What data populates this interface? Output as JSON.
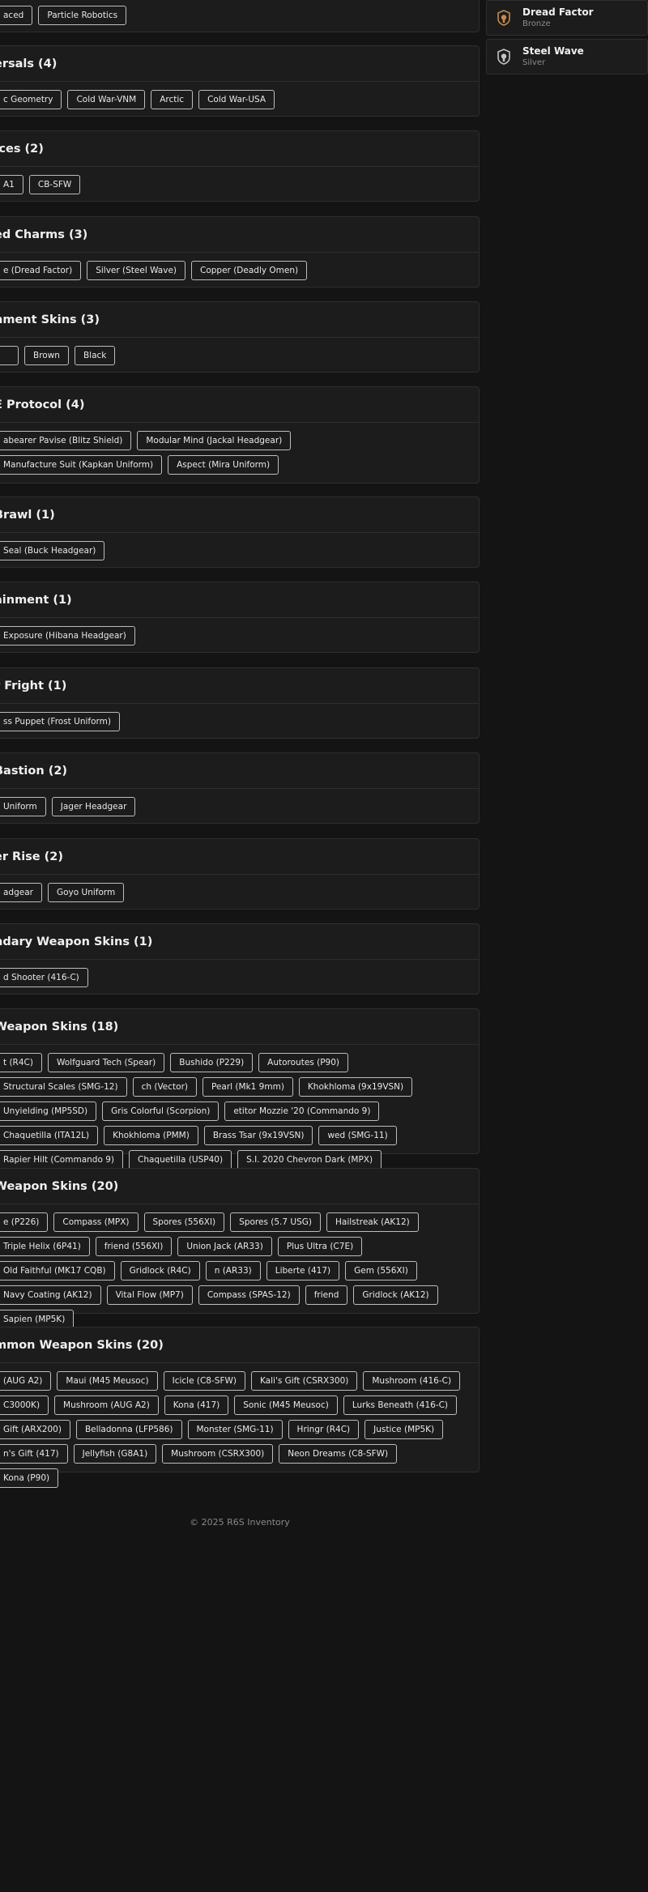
{
  "sections": [
    {
      "title": "",
      "items": [
        "aced",
        "Particle Robotics"
      ]
    },
    {
      "title": "ersals (4)",
      "items": [
        "c Geometry",
        "Cold War-VNM",
        "Arctic",
        "Cold War-USA"
      ]
    },
    {
      "title": "Ices (2)",
      "items": [
        "A1",
        "CB-SFW"
      ]
    },
    {
      "title": "ed Charms (3)",
      "items": [
        "e (Dread Factor)",
        "Silver (Steel Wave)",
        "Copper (Deadly Omen)"
      ]
    },
    {
      "title": "hment Skins (3)",
      "items": [
        "",
        "Brown",
        "Black"
      ]
    },
    {
      "title": "E Protocol (4)",
      "items": [
        "abearer Pavise (Blitz Shield)",
        "Modular Mind (Jackal Headgear)",
        "Manufacture Suit (Kapkan Uniform)",
        "Aspect (Mira Uniform)"
      ]
    },
    {
      "title": "Brawl (1)",
      "items": [
        "Seal (Buck Headgear)"
      ]
    },
    {
      "title": "ainment (1)",
      "items": [
        "Exposure (Hibana Headgear)"
      ]
    },
    {
      "title": "r Fright (1)",
      "items": [
        "ss Puppet (Frost Uniform)"
      ]
    },
    {
      "title": "Bastion (2)",
      "items": [
        "Uniform",
        "Jager Headgear"
      ]
    },
    {
      "title": "er Rise (2)",
      "items": [
        "adgear",
        "Goyo Uniform"
      ]
    },
    {
      "title": "ndary Weapon Skins (1)",
      "items": [
        "d Shooter (416-C)"
      ]
    },
    {
      "title": "Weapon Skins (18)",
      "items": [
        "t (R4C)",
        "Wolfguard Tech (Spear)",
        "Bushido (P229)",
        "Autoroutes (P90)",
        "Structural Scales (SMG-12)",
        "ch (Vector)",
        "Pearl (Mk1 9mm)",
        "Khokhloma (9x19VSN)",
        "Unyielding (MP5SD)",
        "Gris Colorful (Scorpion)",
        "etitor Mozzie '20 (Commando 9)",
        "Chaquetilla (ITA12L)",
        "Khokhloma (PMM)",
        "Brass Tsar (9x19VSN)",
        "wed (SMG-11)",
        "Rapier Hilt (Commando 9)",
        "Chaquetilla (USP40)",
        "S.I. 2020 Chevron Dark (MPX)"
      ]
    },
    {
      "title": "Weapon Skins (20)",
      "items": [
        "e (P226)",
        "Compass (MPX)",
        "Spores (556XI)",
        "Spores (5.7 USG)",
        "Hailstreak (AK12)",
        "Triple Helix (6P41)",
        "friend (556XI)",
        "Union Jack (AR33)",
        "Plus Ultra (C7E)",
        "Old Faithful (MK17 CQB)",
        "Gridlock (R4C)",
        "n (AR33)",
        "Liberte (417)",
        "Gem (556XI)",
        "Navy Coating (AK12)",
        "Vital Flow (MP7)",
        "Compass (SPAS-12)",
        "friend",
        "Gridlock (AK12)",
        "Sapien (MP5K)"
      ]
    },
    {
      "title": "mmon Weapon Skins (20)",
      "items": [
        "(AUG A2)",
        "Maui (M45 Meusoc)",
        "Icicle (C8-SFW)",
        "Kali's Gift (CSRX300)",
        "Mushroom (416-C)",
        "C3000K)",
        "Mushroom (AUG A2)",
        "Kona (417)",
        "Sonic (M45 Meusoc)",
        "Lurks Beneath (416-C)",
        "Gift (ARX200)",
        "Belladonna (LFP586)",
        "Monster (SMG-11)",
        "Hringr (R4C)",
        "Justice (MP5K)",
        "n's Gift (417)",
        "Jellyfish (G8A1)",
        "Mushroom (CSRX300)",
        "Neon Dreams (C8-SFW)",
        "Kona (P90)"
      ]
    }
  ],
  "sidebar": [
    {
      "name": "Dread Factor",
      "tier": "Bronze",
      "icon": "bronze-charm-icon",
      "color": "#c58a4b"
    },
    {
      "name": "Steel Wave",
      "tier": "Silver",
      "icon": "silver-charm-icon",
      "color": "#c4c4c4"
    }
  ],
  "footer": "© 2025 R6S Inventory",
  "colors": {
    "background": "#141414",
    "panel": "#1c1c1c",
    "border": "#2e2e2e",
    "chip_border": "#bdbdbd"
  }
}
